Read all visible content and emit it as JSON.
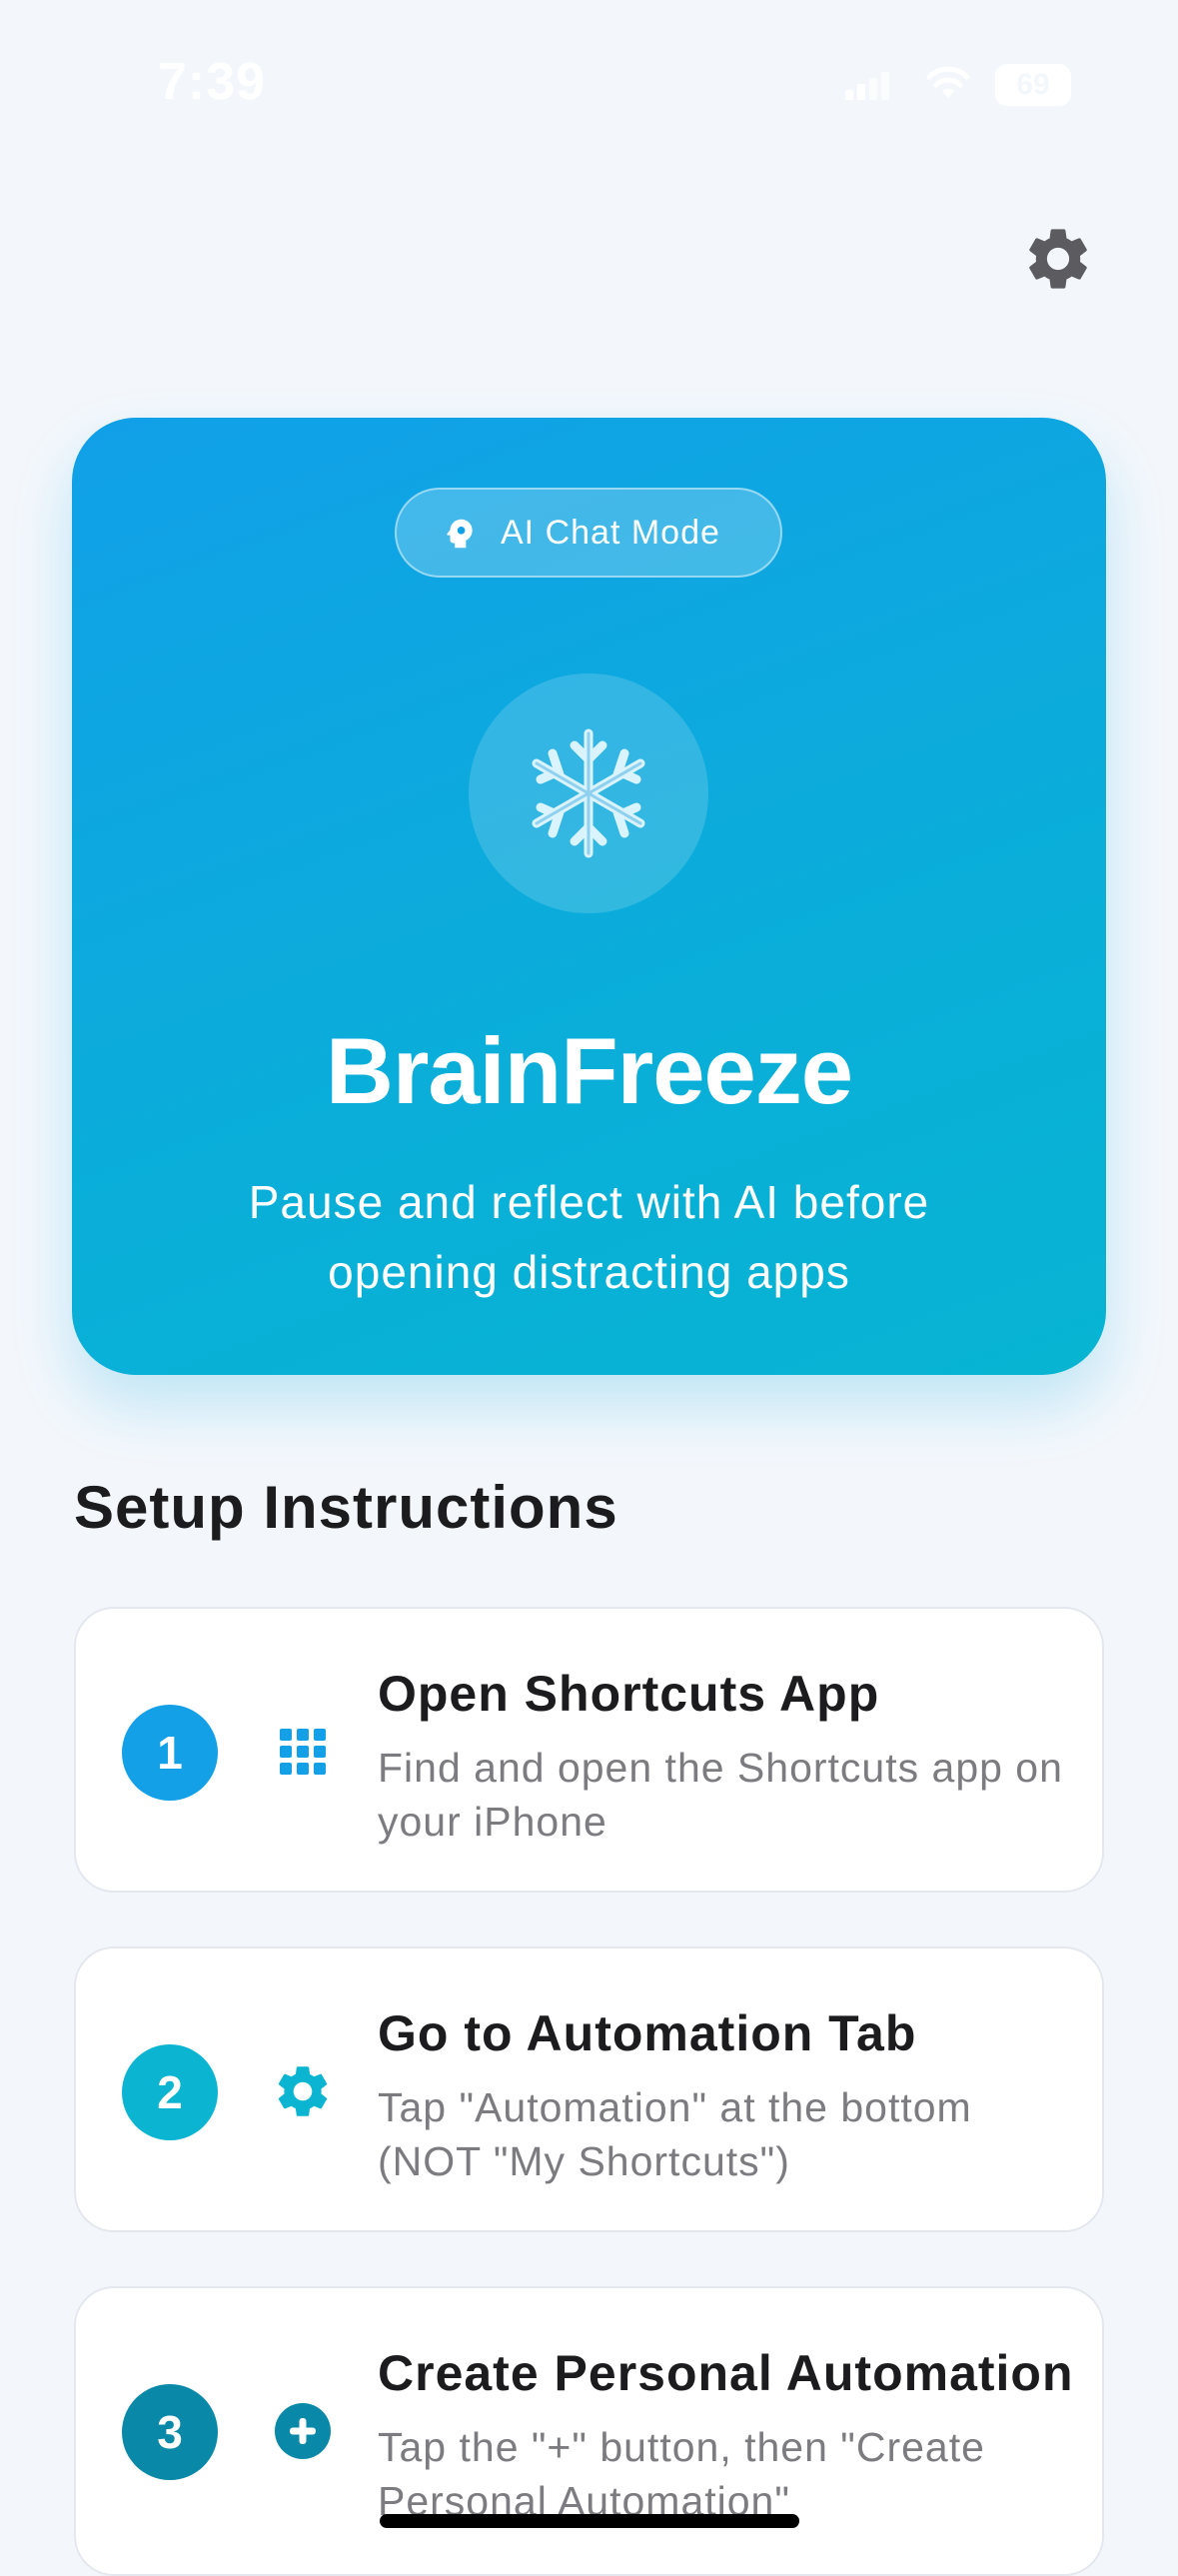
{
  "status_bar": {
    "time": "7:39",
    "battery": "69"
  },
  "header": {
    "settings_icon": "gear-icon"
  },
  "hero": {
    "mode_label": "AI Chat Mode",
    "mode_icon": "brain-head-icon",
    "emoji_icon": "snowflake-icon",
    "title": "BrainFreeze",
    "subtitle": "Pause and reflect with AI before opening distracting apps"
  },
  "instructions": {
    "title": "Setup Instructions",
    "steps": [
      {
        "number": "1",
        "icon": "grid-icon",
        "title": "Open Shortcuts App",
        "description": "Find and open the Shortcuts app on your iPhone"
      },
      {
        "number": "2",
        "icon": "gear-icon",
        "title": "Go to Automation Tab",
        "description": "Tap \"Automation\" at the bottom (NOT \"My Shortcuts\")"
      },
      {
        "number": "3",
        "icon": "plus-circle-icon",
        "title": "Create Personal Automation",
        "description": "Tap the \"+\" button, then \"Create Personal Automation\""
      }
    ]
  },
  "colors": {
    "accent": "#11a0e8",
    "step1": "#13a0e6",
    "step2": "#0bb5d1",
    "step3": "#0a88a8"
  }
}
